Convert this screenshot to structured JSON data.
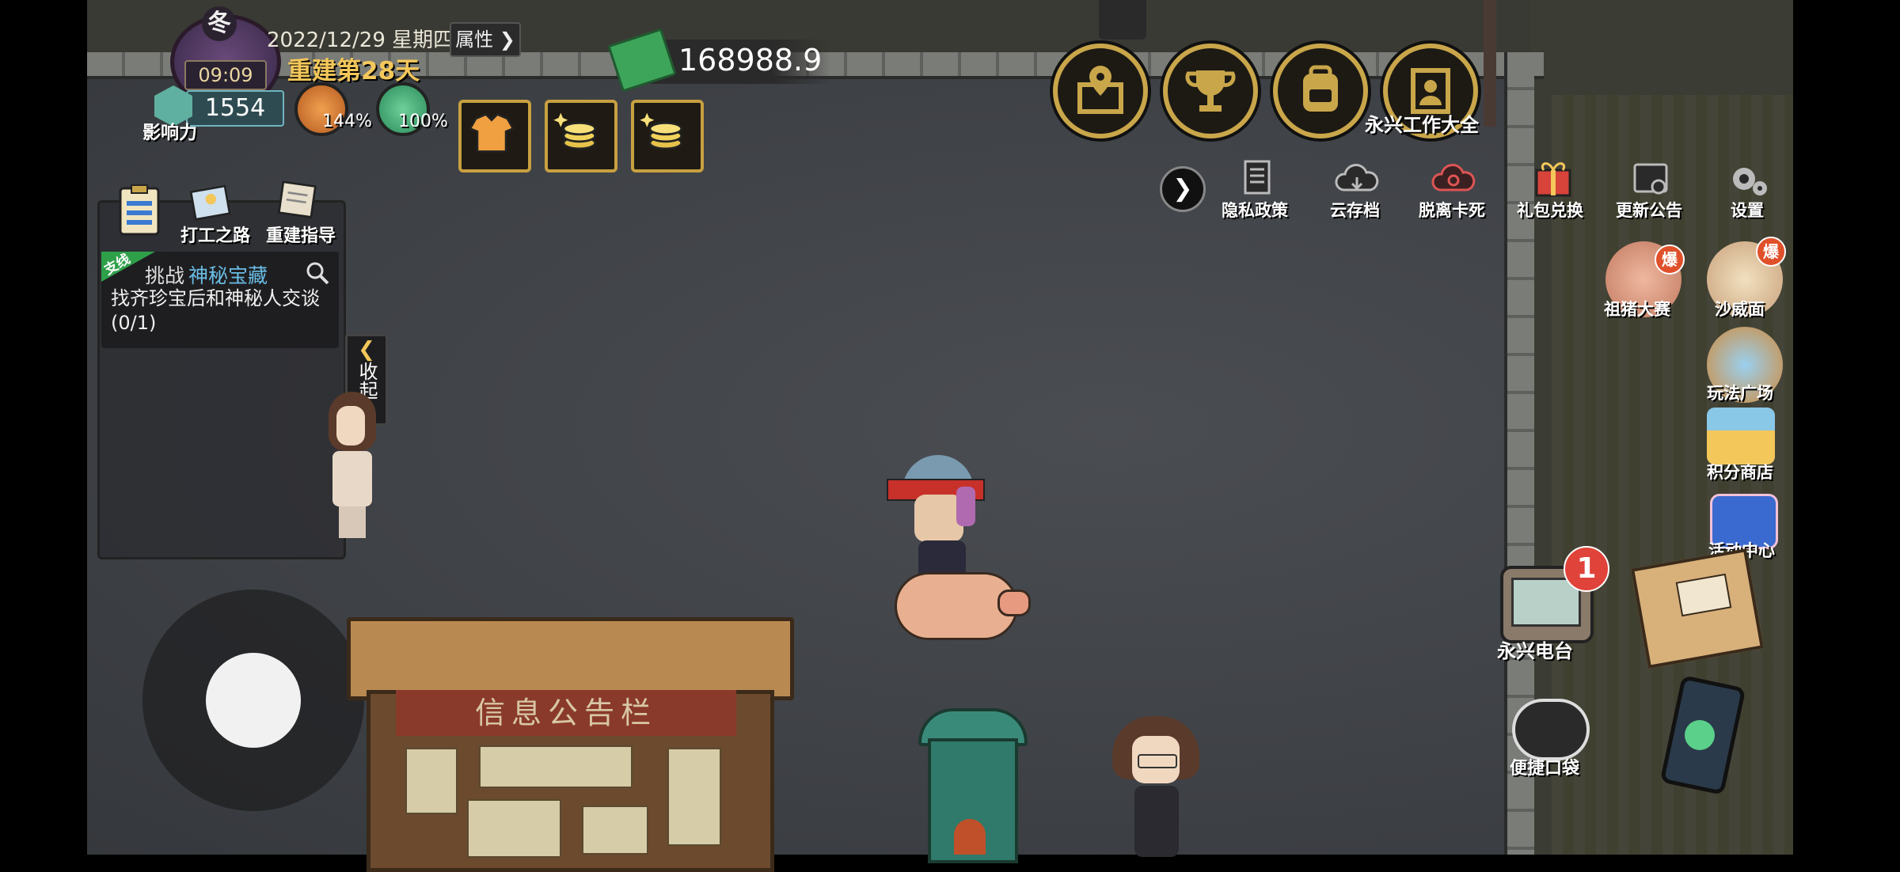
{
  "hud": {
    "season": "冬",
    "clock": "09:09",
    "date": "2022/12/29 星期四",
    "attr_button": "属性",
    "rebuild_day": "重建第28天",
    "influence_value": "1554",
    "influence_label": "影响力",
    "hunger_pct": "144%",
    "health_pct": "100%",
    "cash": "168988.9"
  },
  "top_right": {
    "recruit_label": "永兴工作大全"
  },
  "menu_row": [
    {
      "label": "隐私政策"
    },
    {
      "label": "云存档"
    },
    {
      "label": "脱离卡死"
    },
    {
      "label": "礼包兑换"
    },
    {
      "label": "更新公告"
    },
    {
      "label": "设置"
    }
  ],
  "side_icons": [
    {
      "label": "祖猪大赛",
      "badge": "爆"
    },
    {
      "label": "沙威面",
      "badge": "爆"
    },
    {
      "label": "玩法广场"
    },
    {
      "label": "积分商店"
    },
    {
      "label": "活动中心"
    }
  ],
  "quest_panel": {
    "buttons": [
      {
        "label": "打工之路"
      },
      {
        "label": "重建指导"
      }
    ],
    "tag": "支线",
    "title_prefix": "挑战",
    "title_name": "神秘宝藏",
    "description": "找齐珍宝后和神秘人交谈(0/1)",
    "collapse": "收起"
  },
  "bottom_right": {
    "radio_label": "永兴电台",
    "radio_badge": "1",
    "pocket_label": "便捷口袋"
  },
  "board": {
    "sign": "信息公告栏"
  },
  "colors": {
    "gold_accent": "#c9a64a",
    "rebuild_text": "#f3c75a",
    "quest_name": "#6bbde6"
  }
}
